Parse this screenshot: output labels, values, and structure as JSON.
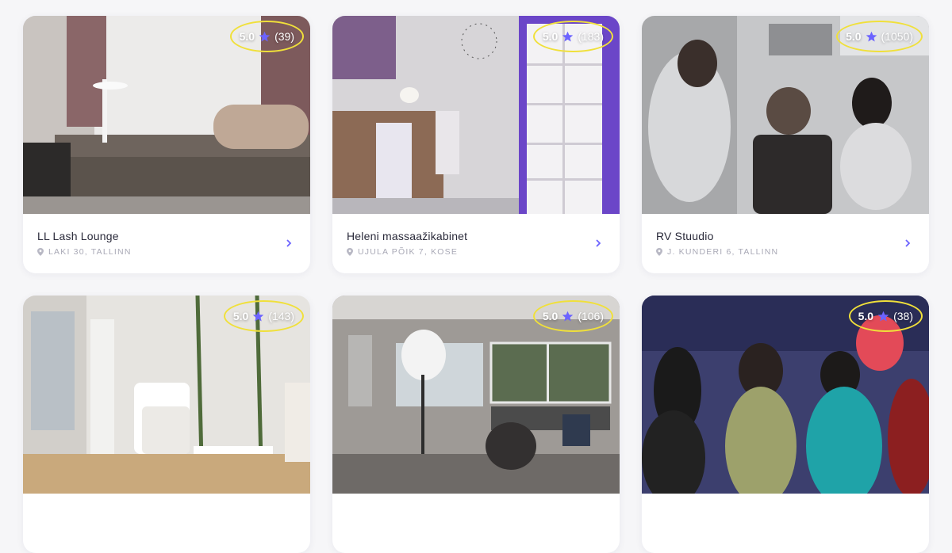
{
  "colors": {
    "accent": "#6c63ff",
    "highlight": "#f0e03a"
  },
  "icons": {
    "star": "star-icon",
    "pin": "location-pin-icon",
    "chevron": "chevron-right-icon"
  },
  "cards": [
    {
      "name": "LL Lash Lounge",
      "address": "LAKI 30, TALLINN",
      "score": "5.0",
      "reviews": "(39)"
    },
    {
      "name": "Heleni massaažikabinet",
      "address": "UJULA PÕIK 7, KOSE",
      "score": "5.0",
      "reviews": "(183)"
    },
    {
      "name": "RV Stuudio",
      "address": "J. KUNDERI 6, TALLINN",
      "score": "5.0",
      "reviews": "(1050)"
    },
    {
      "name": "",
      "address": "",
      "score": "5.0",
      "reviews": "(143)"
    },
    {
      "name": "",
      "address": "",
      "score": "5.0",
      "reviews": "(106)"
    },
    {
      "name": "",
      "address": "",
      "score": "5.0",
      "reviews": "(38)"
    }
  ]
}
